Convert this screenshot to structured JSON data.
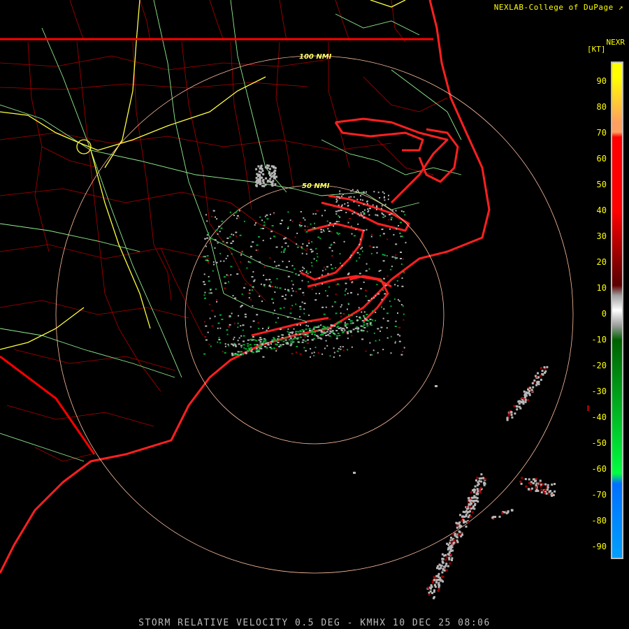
{
  "header": {
    "credit": "NEXLAB-College of DuPage",
    "product": "NEXR",
    "unit": "[KT]"
  },
  "legend": {
    "ticks": [
      "90",
      "80",
      "70",
      "60",
      "50",
      "40",
      "30",
      "20",
      "10",
      "0",
      "-10",
      "-20",
      "-30",
      "-40",
      "-50",
      "-60",
      "-70",
      "-80",
      "-90"
    ],
    "colors": {
      "yellow": "#ffff00",
      "orange": "#ffa060",
      "red": "#ff0000",
      "dark_red": "#600000",
      "gray": "#a0a0a0",
      "dark_green": "#006000",
      "green": "#00ff40",
      "blue": "#0070ff",
      "light_blue": "#00a0ff"
    }
  },
  "map": {
    "range_rings": [
      {
        "label": "100 NMI"
      },
      {
        "label": "50 NMI"
      }
    ],
    "colors": {
      "background": "#000000",
      "coastline": "#ff2020",
      "state_border": "#ff0000",
      "county_border": "#c00000",
      "highway": "#90ee90",
      "interstate": "#ffff40",
      "ring": "#ffc0a0",
      "echo_gray": "#b8b8b8",
      "echo_green": "#00b030",
      "echo_red": "#a00000"
    }
  },
  "footer": {
    "title": "STORM RELATIVE VELOCITY 0.5 DEG - KMHX 10 DEC 25 08:06"
  }
}
